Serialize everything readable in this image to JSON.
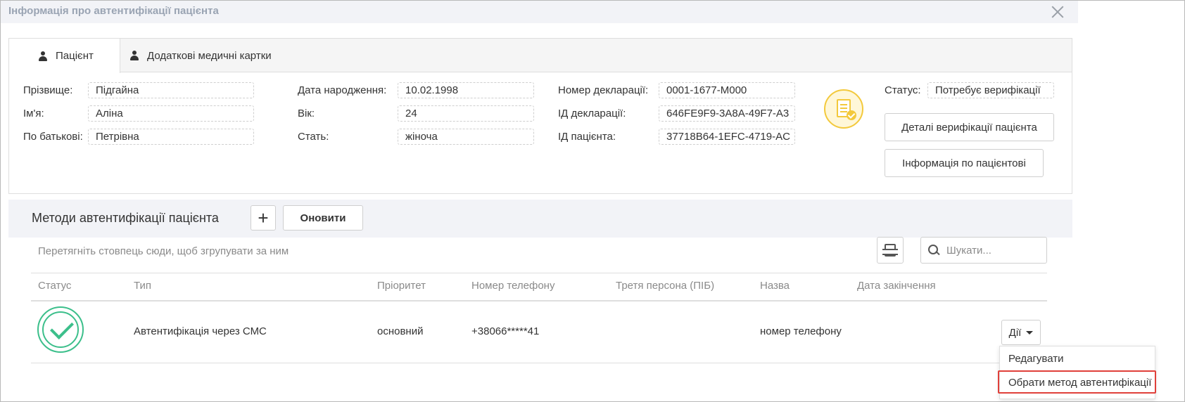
{
  "modal": {
    "title": "Інформація про автентифікації пацієнта"
  },
  "tabs": [
    {
      "label": "Пацієнт"
    },
    {
      "label": "Додаткові медичні картки"
    }
  ],
  "patient": {
    "surname": {
      "label": "Прізвище:",
      "value": "Підгайна"
    },
    "name": {
      "label": "Ім'я:",
      "value": "Аліна"
    },
    "patronymic": {
      "label": "По батькові:",
      "value": "Петрівна"
    },
    "birth_date": {
      "label": "Дата народження:",
      "value": "10.02.1998"
    },
    "age": {
      "label": "Вік:",
      "value": "24"
    },
    "sex": {
      "label": "Стать:",
      "value": "жіноча"
    },
    "declaration_number": {
      "label": "Номер декларації:",
      "value": "0001-1677-M000"
    },
    "declaration_id": {
      "label": "ІД декларації:",
      "value": "646FE9F9-3A8A-49F7-A3"
    },
    "patient_id": {
      "label": "ІД пацієнта:",
      "value": "37718B64-1EFC-4719-AC"
    },
    "status": {
      "label": "Статус:",
      "value": "Потребує верифікації"
    }
  },
  "buttons": {
    "verification_details": "Деталі верифікації пацієнта",
    "patient_info": "Інформація по пацієнтові"
  },
  "methods": {
    "title": "Методи автентифікації пацієнта",
    "add_label": "+",
    "refresh_label": "Оновити",
    "group_hint": "Перетягніть стовпець сюди, щоб згрупувати за ним",
    "search_placeholder": "Шукати..."
  },
  "grid": {
    "columns": [
      "Статус",
      "Тип",
      "Пріоритет",
      "Номер телефону",
      "Третя персона (ПІБ)",
      "Назва",
      "Дата закінчення"
    ],
    "rows": [
      {
        "type": "Автентифікація через СМС",
        "priority": "основний",
        "phone": "+38066*****41",
        "third_person": "",
        "name": "номер телефону",
        "end_date": ""
      }
    ],
    "actions_label": "Дії"
  },
  "dropdown": {
    "items": [
      "Редагувати",
      "Обрати метод автентифікації"
    ]
  },
  "colors": {
    "success": "#3cbf8b",
    "warning": "#f3c93c",
    "highlight": "#e0403a"
  }
}
